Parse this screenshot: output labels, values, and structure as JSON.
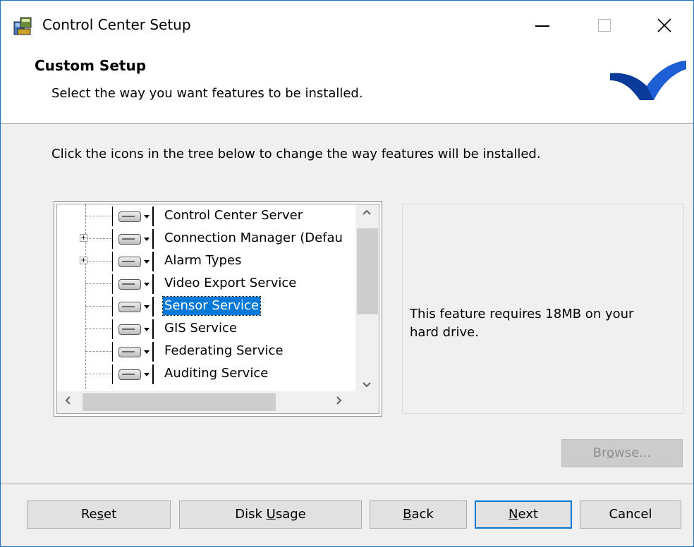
{
  "window": {
    "title": "Control Center Setup"
  },
  "banner": {
    "title": "Custom Setup",
    "subtitle": "Select the way you want features to be installed."
  },
  "instruction": "Click the icons in the tree below to change the way features will be installed.",
  "tree": {
    "items": [
      {
        "label": "Control Center Server",
        "expandable": false,
        "selected": false
      },
      {
        "label": "Connection Manager (Defau",
        "expandable": true,
        "selected": false
      },
      {
        "label": "Alarm Types",
        "expandable": true,
        "selected": false
      },
      {
        "label": "Video Export Service",
        "expandable": false,
        "selected": false
      },
      {
        "label": "Sensor Service",
        "expandable": false,
        "selected": true
      },
      {
        "label": "GIS Service",
        "expandable": false,
        "selected": false
      },
      {
        "label": "Federating Service",
        "expandable": false,
        "selected": false
      },
      {
        "label": "Auditing Service",
        "expandable": false,
        "selected": false
      }
    ],
    "expander_glyph": "+",
    "icon": "hard-drive-icon"
  },
  "info": {
    "text": "This feature requires 18MB on your hard drive."
  },
  "buttons": {
    "browse": {
      "pre": "Br",
      "key": "o",
      "post": "wse..."
    },
    "reset": {
      "pre": "Re",
      "key": "s",
      "post": "et"
    },
    "disk_usage": {
      "pre": "Disk ",
      "key": "U",
      "post": "sage"
    },
    "back": {
      "pre": "",
      "key": "B",
      "post": "ack"
    },
    "next": {
      "pre": "",
      "key": "N",
      "post": "ext"
    },
    "cancel": {
      "pre": "Cancel",
      "key": "",
      "post": ""
    }
  },
  "colors": {
    "selection": "#0078d7",
    "logo": "#0a3a9a",
    "default_button_border": "#0078d7"
  }
}
